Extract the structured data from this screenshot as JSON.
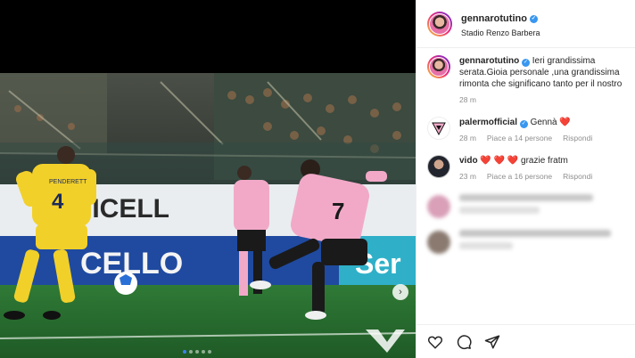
{
  "post": {
    "username": "gennarotutino",
    "location": "Stadio Renzo Barbera"
  },
  "media": {
    "ad_board_text_1": "ONTICELL",
    "ad_board_text_2": "CELLO",
    "ad_board_text_3": "Ser",
    "jersey_number_striker": "7",
    "jersey_number_defender": "4",
    "jersey_name_defender": "PENDERETT",
    "carousel_count": 5,
    "carousel_active_index": 1
  },
  "caption": {
    "username": "gennarotutino",
    "text": "Ieri grandissima serata.Gioia personale ,una grandissima rimonta che significano tanto per il nostro cammino ! Bravi a tutti, grazie a te 🦅❤️🖤⚽",
    "time": "28 m"
  },
  "comments": [
    {
      "username": "palermofficial",
      "text": "Gennà ❤️",
      "time": "28 m",
      "likes": "Piace a 14 persone",
      "reply": "Rispondi"
    },
    {
      "username": "vido",
      "text": "❤️ ❤️ ❤️  grazie fratm",
      "time": "23 m",
      "likes": "Piace a 16 persone",
      "reply": "Rispondi"
    }
  ],
  "actions": {
    "like_icon": "heart-icon",
    "comment_icon": "comment-icon",
    "share_icon": "send-icon"
  },
  "colors": {
    "verified_blue": "#3897f0",
    "palermo_pink": "#f2a9c8",
    "opponent_yellow": "#f2d02a"
  }
}
